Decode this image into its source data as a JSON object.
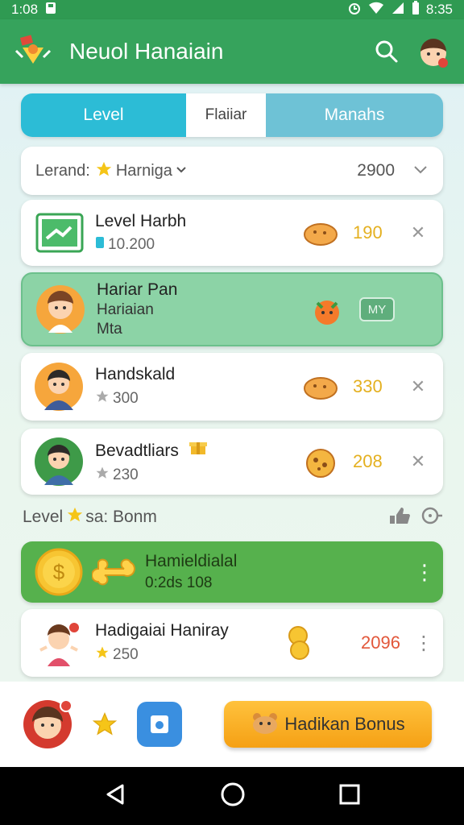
{
  "status": {
    "time_left": "1:08",
    "time_right": "8:35"
  },
  "app": {
    "title": "Neuol Hanaiain"
  },
  "tabs": [
    {
      "label": "Level"
    },
    {
      "label": "Flaiiar"
    },
    {
      "label": "Manahs"
    }
  ],
  "filter": {
    "label": "Lerand:",
    "value": "Harniga",
    "score": "2900"
  },
  "rows": [
    {
      "name": "Level Harbh",
      "sub": "10.200",
      "score": "190"
    },
    {
      "name": "Hariar Pan",
      "sub": "Hariaian",
      "sub2": "Mta",
      "badge": "MY"
    },
    {
      "name": "Handskald",
      "sub": "300",
      "score": "330"
    },
    {
      "name": "Bevadtliars",
      "sub": "230",
      "score": "208"
    }
  ],
  "section": {
    "label_a": "Level",
    "label_b": "sa: Bonm"
  },
  "bonus_row": {
    "name": "Hamieldialal",
    "sub": "0:2ds 108"
  },
  "last_row": {
    "name": "Hadigaiai Haniray",
    "sub": "250",
    "score": "2096"
  },
  "bottom": {
    "bonus_button": "Hadikan Bonus"
  },
  "colors": {
    "accent_green": "#36a35c",
    "teal": "#2cbcd6",
    "gold": "#e4b020",
    "orange": "#f7a21b"
  }
}
